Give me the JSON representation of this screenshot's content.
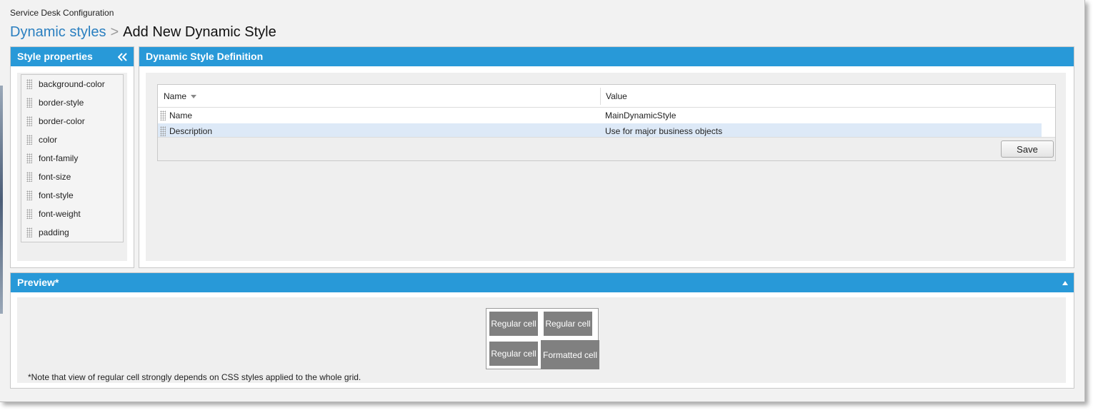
{
  "app": {
    "title": "Service Desk Configuration"
  },
  "breadcrumb": {
    "parent": "Dynamic styles",
    "separator": ">",
    "current": "Add New Dynamic Style"
  },
  "style_properties": {
    "title": "Style properties",
    "items": [
      "background-color",
      "border-style",
      "border-color",
      "color",
      "font-family",
      "font-size",
      "font-style",
      "font-weight",
      "padding"
    ]
  },
  "definition": {
    "title": "Dynamic Style Definition",
    "columns": {
      "name": "Name",
      "value": "Value"
    },
    "rows": [
      {
        "name": "Name",
        "value": "MainDynamicStyle"
      },
      {
        "name": "Description",
        "value": "Use for major business objects"
      }
    ],
    "save_label": "Save"
  },
  "preview": {
    "title": "Preview*",
    "cells": [
      "Regular cell",
      "Regular cell",
      "Regular cell",
      "Formatted cell"
    ],
    "note": "*Note that view of regular cell strongly depends on CSS styles applied to the whole grid."
  },
  "colors": {
    "accent": "#2899d8",
    "link": "#2a7fc0",
    "preview_cell": "#808080",
    "selected_row": "#dde9f7"
  }
}
